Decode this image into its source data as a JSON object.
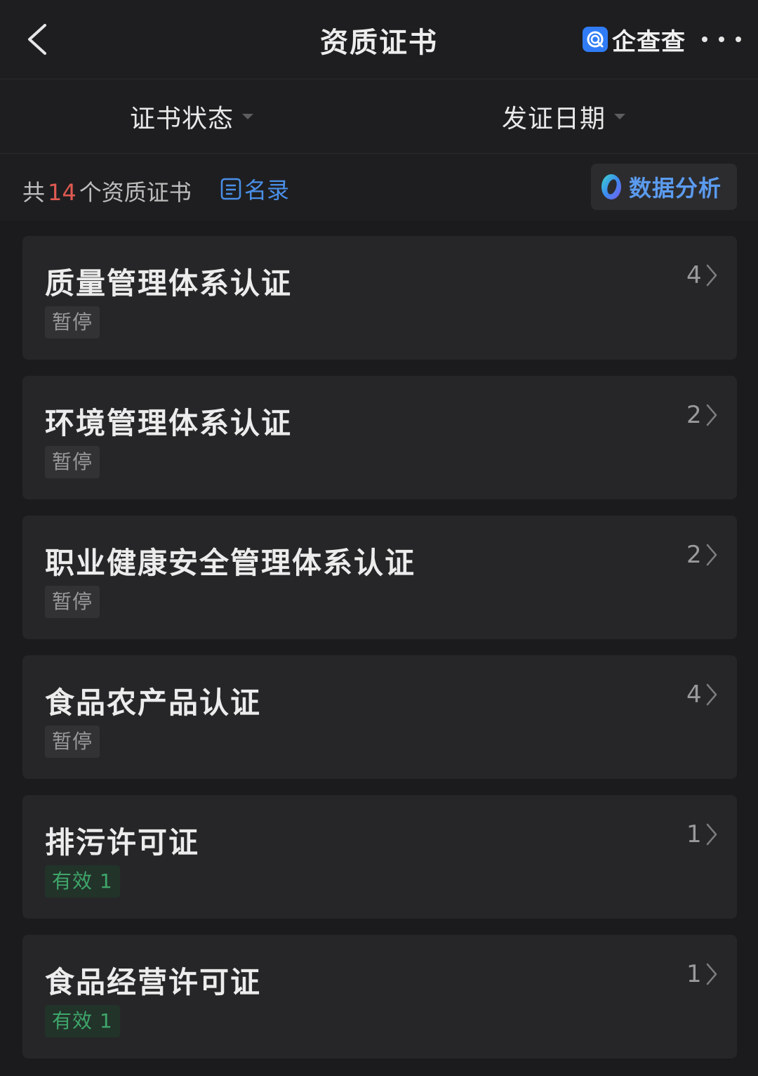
{
  "header": {
    "title": "资质证书",
    "brand_name": "企查查"
  },
  "filters": [
    {
      "label": "证书状态"
    },
    {
      "label": "发证日期"
    }
  ],
  "summary": {
    "prefix": "共",
    "count": "14",
    "suffix": "个资质证书",
    "roster_label": "名录",
    "analysis_label": "数据分析"
  },
  "certificates": [
    {
      "name": "质量管理体系认证",
      "status": "暂停",
      "status_type": "suspended",
      "count": "4"
    },
    {
      "name": "环境管理体系认证",
      "status": "暂停",
      "status_type": "suspended",
      "count": "2"
    },
    {
      "name": "职业健康安全管理体系认证",
      "status": "暂停",
      "status_type": "suspended",
      "count": "2"
    },
    {
      "name": "食品农产品认证",
      "status": "暂停",
      "status_type": "suspended",
      "count": "4"
    },
    {
      "name": "排污许可证",
      "status": "有效 1",
      "status_type": "valid",
      "count": "1"
    },
    {
      "name": "食品经营许可证",
      "status": "有效 1",
      "status_type": "valid",
      "count": "1"
    }
  ],
  "colors": {
    "background": "#1b1b1d",
    "card": "#262628",
    "count_highlight": "#e05a52",
    "link_blue": "#4a8fe7",
    "valid_green": "#3fa66a",
    "brand_blue": "#2f7cf6"
  },
  "icons": [
    "back-chevron-icon",
    "brand-logo-icon",
    "more-icon",
    "caret-down-icon",
    "roster-list-icon",
    "data-analysis-icon",
    "chevron-right-icon"
  ]
}
